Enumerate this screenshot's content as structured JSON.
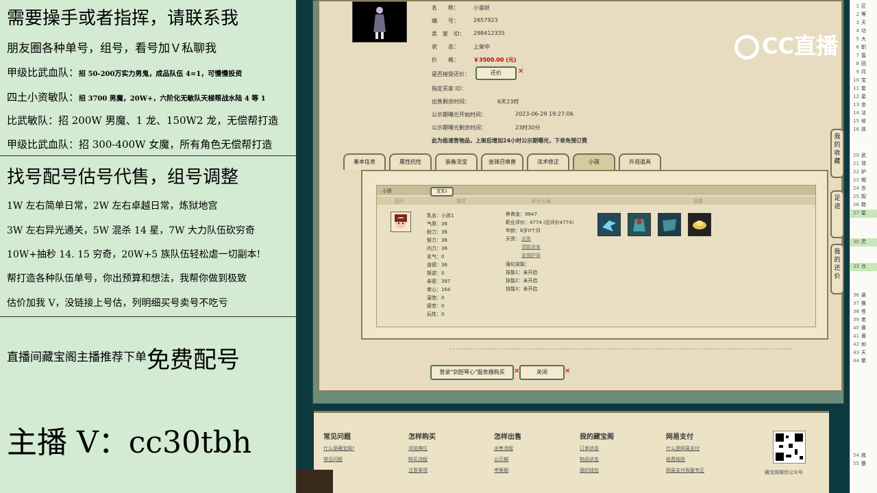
{
  "overlay": {
    "line1": "需要操手或者指挥，请联系我",
    "line2": "朋友圈各种单号，组号，看号加Ｖ私聊我",
    "line3_a": "甲级比武血队：",
    "line3_b": "招 50-200万实力男鬼，成品队伍 4=1，可慢慢投资",
    "line4_a": "四土小资敏队：",
    "line4_b": "招 3700 男魔，20W+，六阶化无敏队天梯帮战水陆 4 等 1",
    "line5": "比武敏队：招 200W 男魔、1 龙、150W2 龙，无偿帮打造",
    "line6": "甲级比武血队：招 300-400W 女魔，所有角色无偿帮打造",
    "line7": "找号配号估号代售，组号调整",
    "line8": "1W 左右简单日常，2W 左右卓越日常，炼狱地宫",
    "line9": "3W 左右异光通关，5W 混杀 14 星，7W 大力队伍砍穷奇",
    "line10": "10W+抽秒 14. 15 穷奇，20W+5 族队伍轻松虐一切副本!",
    "line11": "帮打造各种队伍单号，你出预算和想法，我帮你做到极致",
    "line12": "估价加我 V，没链接上号估，列明细买号卖号不吃亏",
    "line13_a": "直播间藏宝阁主播推荐下单",
    "line13_b": "免费配号",
    "line14": "主播 V：cc30tbh"
  },
  "item": {
    "name_label": "名　　称：",
    "name_value": "小蛮妖",
    "id_label": "编　　号：",
    "id_value": "2657923",
    "seller_label": "卖　家　ID：",
    "seller_value": "298412335",
    "status_label": "状　　态：",
    "status_value": "上架中",
    "price_label": "价　　格：",
    "price_value": "￥3500.00 (元)",
    "counter_label": "是否接受还价：",
    "counter_button": "还价",
    "buyer_label": "指定买家 ID：",
    "remaining_label": "出售剩余时间：",
    "remaining_value": "6天23时",
    "public_start_label": "公示期曝光开始时间：",
    "public_start_value": "2023-06-29 19:27:06",
    "public_left_label": "公示期曝光剩余时间：",
    "public_left_value": "23时30分",
    "notice_a": "此为极速售物品，上架后增加24小时公示期曝光，下单免预订费"
  },
  "tabs": [
    "基本信息",
    "属性抗性",
    "装备法宝",
    "坐骑召唤兽",
    "法术修正",
    "小孩",
    "外观道具"
  ],
  "child": {
    "section_label": "小孩",
    "subtab": "宝宝1",
    "headers": [
      "图片",
      "属性",
      "职业天赋",
      "装备"
    ],
    "attrs": [
      "乳名：小孩1",
      "气质：36",
      "耐力：36",
      "智力：36",
      "内力：36",
      "名气：0",
      "道德：36",
      "叛逆：0",
      "亲密：387",
      "孝心：164",
      "温饱：0",
      "疲劳：0",
      "玩性：0"
    ],
    "info1": "养育金：9647",
    "info2": "职业评价：4774 (旧评价4774)",
    "info3": "年龄：6岁0个月",
    "info4": "天资：",
    "talent1": "志愿",
    "talent2": "潜能迸发",
    "talent3": "金钢护体",
    "skill_header": "强化技能：",
    "skill1": "技能1：未开启",
    "skill2": "技能2：未开启",
    "skill3": "技能3：未开启"
  },
  "buttons": {
    "login": "登录\"剑胆琴心\"服务器购买",
    "close": "关闭"
  },
  "logo": {
    "text": "CC直播"
  },
  "right_tabs": [
    "我的收藏",
    "足迹",
    "我的还价"
  ],
  "footer": {
    "cols": [
      {
        "title": "常见问题",
        "links": [
          "什么是藏宝阁?",
          "常见问题"
        ]
      },
      {
        "title": "怎样购买",
        "links": [
          "浏览摊位",
          "购买流程",
          "注意事项"
        ]
      },
      {
        "title": "怎样出售",
        "links": [
          "出售流程",
          "公示期",
          "考察期"
        ]
      },
      {
        "title": "我的藏宝阁",
        "links": [
          "订单状态",
          "物品状态",
          "我的钱包"
        ]
      },
      {
        "title": "网易支付",
        "links": [
          "什么是网易支付",
          "收费规则",
          "网易支付客服专区"
        ]
      }
    ],
    "qr_caption": "藏宝阁微信公众号"
  },
  "sidebar": [
    {
      "n": "1",
      "t": "区"
    },
    {
      "n": "2",
      "t": "等"
    },
    {
      "n": "3",
      "t": "天"
    },
    {
      "n": "4",
      "t": "功"
    },
    {
      "n": "5",
      "t": "大"
    },
    {
      "n": "6",
      "t": "职"
    },
    {
      "n": "7",
      "t": "盔"
    },
    {
      "n": "8",
      "t": "回"
    },
    {
      "n": "9",
      "t": "月"
    },
    {
      "n": "10",
      "t": "宝"
    },
    {
      "n": "11",
      "t": "套"
    },
    {
      "n": "12",
      "t": "星"
    },
    {
      "n": "13",
      "t": "坐"
    },
    {
      "n": "14",
      "t": "法"
    },
    {
      "n": "15",
      "t": "修"
    },
    {
      "n": "16",
      "t": "孩"
    },
    {
      "n": "20",
      "t": "武"
    },
    {
      "n": "21",
      "t": "项"
    },
    {
      "n": "22",
      "t": "护"
    },
    {
      "n": "23",
      "t": "帽"
    },
    {
      "n": "24",
      "t": "衣"
    },
    {
      "n": "25",
      "t": "配"
    },
    {
      "n": "26",
      "t": "鞋"
    },
    {
      "n": "27",
      "t": "星"
    },
    {
      "n": "30",
      "t": "灵"
    },
    {
      "n": "33",
      "t": "仓"
    },
    {
      "n": "36",
      "t": "装"
    },
    {
      "n": "37",
      "t": "狠"
    },
    {
      "n": "38",
      "t": "苍"
    },
    {
      "n": "39",
      "t": "老"
    },
    {
      "n": "40",
      "t": "黄"
    },
    {
      "n": "41",
      "t": "黄"
    },
    {
      "n": "42",
      "t": "如"
    },
    {
      "n": "43",
      "t": "天"
    },
    {
      "n": "44",
      "t": "聚"
    },
    {
      "n": "54",
      "t": "底"
    },
    {
      "n": "55",
      "t": "整"
    }
  ]
}
